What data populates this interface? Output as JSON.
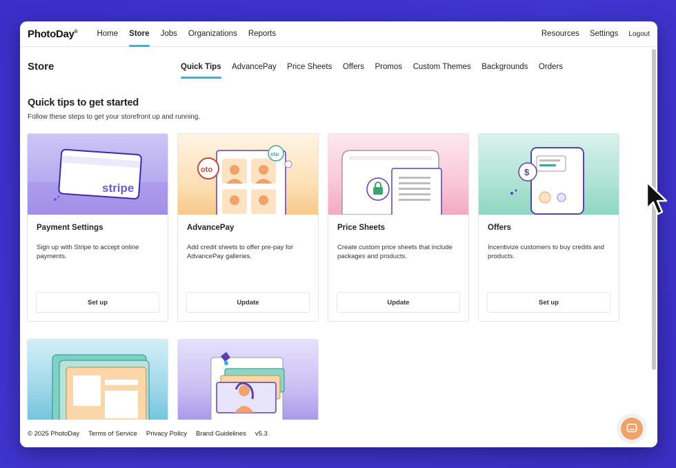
{
  "app": {
    "logo": "PhotoDay"
  },
  "topnav": {
    "items": [
      "Home",
      "Store",
      "Jobs",
      "Organizations",
      "Reports"
    ],
    "active": "Store",
    "right": [
      "Resources",
      "Settings"
    ],
    "logout": "Logout"
  },
  "page": {
    "title": "Store",
    "subtabs": [
      "Quick Tips",
      "AdvancePay",
      "Price Sheets",
      "Offers",
      "Promos",
      "Custom Themes",
      "Backgrounds",
      "Orders"
    ],
    "active_subtab": "Quick Tips"
  },
  "section": {
    "title": "Quick tips to get started",
    "subtitle": "Follow these steps to get your storefront up and running."
  },
  "cards": [
    {
      "title": "Payment Settings",
      "desc": "Sign up with Stripe to accept online payments.",
      "button": "Set up",
      "art_text": "stripe"
    },
    {
      "title": "AdvancePay",
      "desc": "Add credit sheets to offer pre-pay for AdvancePay galleries.",
      "button": "Update",
      "art_text": "oto"
    },
    {
      "title": "Price Sheets",
      "desc": "Create custom price sheets that include packages and products.",
      "button": "Update"
    },
    {
      "title": "Offers",
      "desc": "Incentivize customers to buy credits and products.",
      "button": "Set up",
      "art_text": "$"
    }
  ],
  "footer": {
    "copyright": "© 2025 PhotoDay",
    "links": [
      "Terms of Service",
      "Privacy Policy",
      "Brand Guidelines"
    ],
    "version": "v5.3"
  },
  "colors": {
    "accent": "#2bb7e6",
    "chat": "#f0a26a",
    "background": "#3b2fc9"
  },
  "icons": {
    "chat": "chat-bubble-icon",
    "cursor": "mouse-pointer-icon"
  }
}
